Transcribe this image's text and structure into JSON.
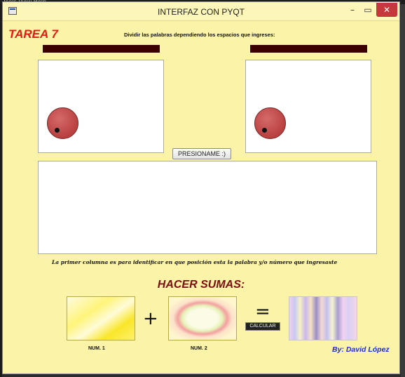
{
  "background": {
    "menubar_text": "Tools  View  Help"
  },
  "window": {
    "title": "INTERFAZ CON PYQT",
    "controls": {
      "minimize": "–",
      "maximize": "▭",
      "close": "✕"
    }
  },
  "header": {
    "tarea_title": "TAREA 7",
    "instruction": "Dividir las palabras dependiendo los espacios que ingreses:"
  },
  "main": {
    "press_button_label": "PRESIONAME :)",
    "caption": "La primer columna es para identificar en que posición esta la palabra y/o número que ingresaste"
  },
  "sumas": {
    "title": "HACER SUMAS:",
    "plus": "+",
    "equals": "=",
    "calc_button_label": "CALCULAR",
    "num1_label": "NUM. 1",
    "num2_label": "NUM. 2"
  },
  "footer": {
    "author": "By: David López"
  },
  "colors": {
    "window_bg": "#fbf3a8",
    "title_red": "#e41a12",
    "input_bar": "#3b0000",
    "dial": "#c04a4a",
    "sumas_title": "#7b0f0f",
    "author_blue": "#1d2fd8",
    "close_button": "#c7383c"
  }
}
